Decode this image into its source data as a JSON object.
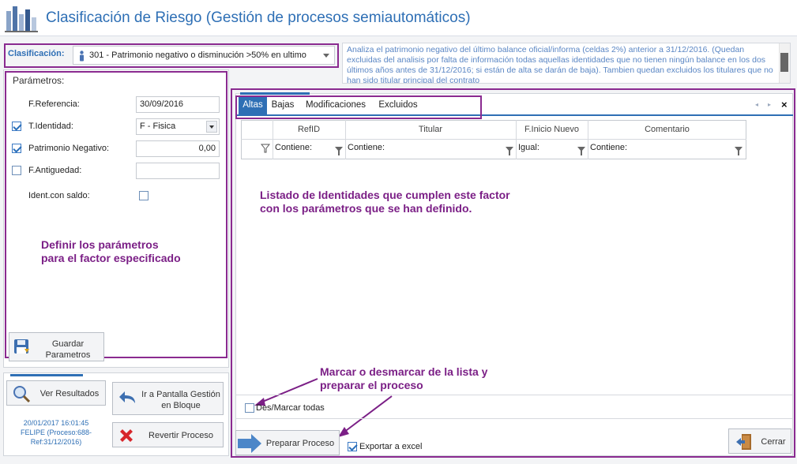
{
  "window": {
    "title": "Clasificación de Riesgo (Gestión de procesos semiautomáticos)"
  },
  "classification": {
    "label": "Clasificación:",
    "selected": "301 - Patrimonio negativo o disminución >50% en ultimo",
    "description": "Analiza el patrimonio negativo del último balance oficial/informa (celdas 2%) anterior a 31/12/2016. (Quedan excluidas del analisis por falta de información todas aquellas identidades que no tienen ningún balance en los dos últimos años antes de 31/12/2016; si están de alta se darán de baja). Tambien quedan excluidos los titulares que no han sido titular principal del contrato"
  },
  "params": {
    "title": "Parámetros:",
    "f_referencia": {
      "label": "F.Referencia:",
      "value": "30/09/2016"
    },
    "t_identidad": {
      "label": "T.Identidad:",
      "value": "F - Fisica",
      "checked": true
    },
    "patrimonio_negativo": {
      "label": "Patrimonio Negativo:",
      "value": "0,00",
      "checked": true
    },
    "f_antiguedad": {
      "label": "F.Antiguedad:",
      "value": "",
      "checked": false
    },
    "ident_con_saldo": {
      "label": "Ident.con saldo:",
      "checked": false
    },
    "save_button": "Guardar Parametros",
    "annotation": "Definir los parámetros para el factor especificado"
  },
  "actions": {
    "ver_resultados": "Ver Resultados",
    "ir_pantalla": "Ir a Pantalla Gestión en Bloque",
    "revertir": "Revertir Proceso",
    "info_line1": "20/01/2017 16:01:45",
    "info_line2": "FELIPE (Proceso:688-",
    "info_line3": "Ref:31/12/2016)"
  },
  "tabs": [
    {
      "label": "Altas",
      "active": true
    },
    {
      "label": "Bajas",
      "active": false
    },
    {
      "label": "Modificaciones",
      "active": false
    },
    {
      "label": "Excluidos",
      "active": false
    }
  ],
  "grid": {
    "columns": [
      "RefID",
      "Titular",
      "F.Inicio Nuevo",
      "Comentario"
    ],
    "filters": [
      "Contiene:",
      "Contiene:",
      "Igual:",
      "Contiene:"
    ],
    "annotation": "Listado de Identidades que cumplen este factor con los parámetros que se han definido."
  },
  "footer": {
    "select_all": "Des/Marcar todas",
    "select_annotation": "Marcar o desmarcar de la lista y preparar el proceso",
    "prepare_button": "Preparar Proceso",
    "export_excel": "Exportar a excel",
    "export_checked": true,
    "close_button": "Cerrar"
  },
  "colors": {
    "accent": "#2e6fb5",
    "annotation": "#7b1f86"
  }
}
